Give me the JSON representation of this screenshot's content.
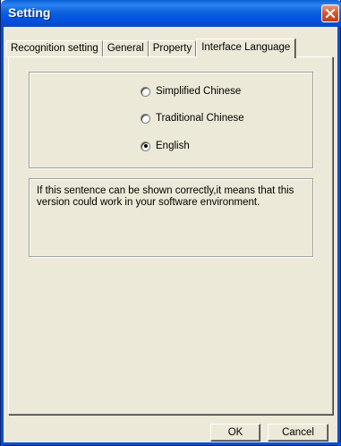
{
  "window": {
    "title": "Setting"
  },
  "tabs": [
    {
      "label": "Recognition setting",
      "active": false
    },
    {
      "label": "General",
      "active": false
    },
    {
      "label": "Property",
      "active": false
    },
    {
      "label": "Interface Language",
      "active": true
    }
  ],
  "language": {
    "options": [
      {
        "label": "Simplified Chinese",
        "checked": false
      },
      {
        "label": "Traditional Chinese",
        "checked": false
      },
      {
        "label": "English",
        "checked": true
      }
    ]
  },
  "info_text": "If this sentence can be shown correctly,it means that this version could work in your software environment.",
  "buttons": {
    "ok": "OK",
    "cancel": "Cancel"
  },
  "colors": {
    "titlebar": "#0054e3",
    "close": "#c13a16",
    "dialog_bg": "#ece9d8"
  }
}
